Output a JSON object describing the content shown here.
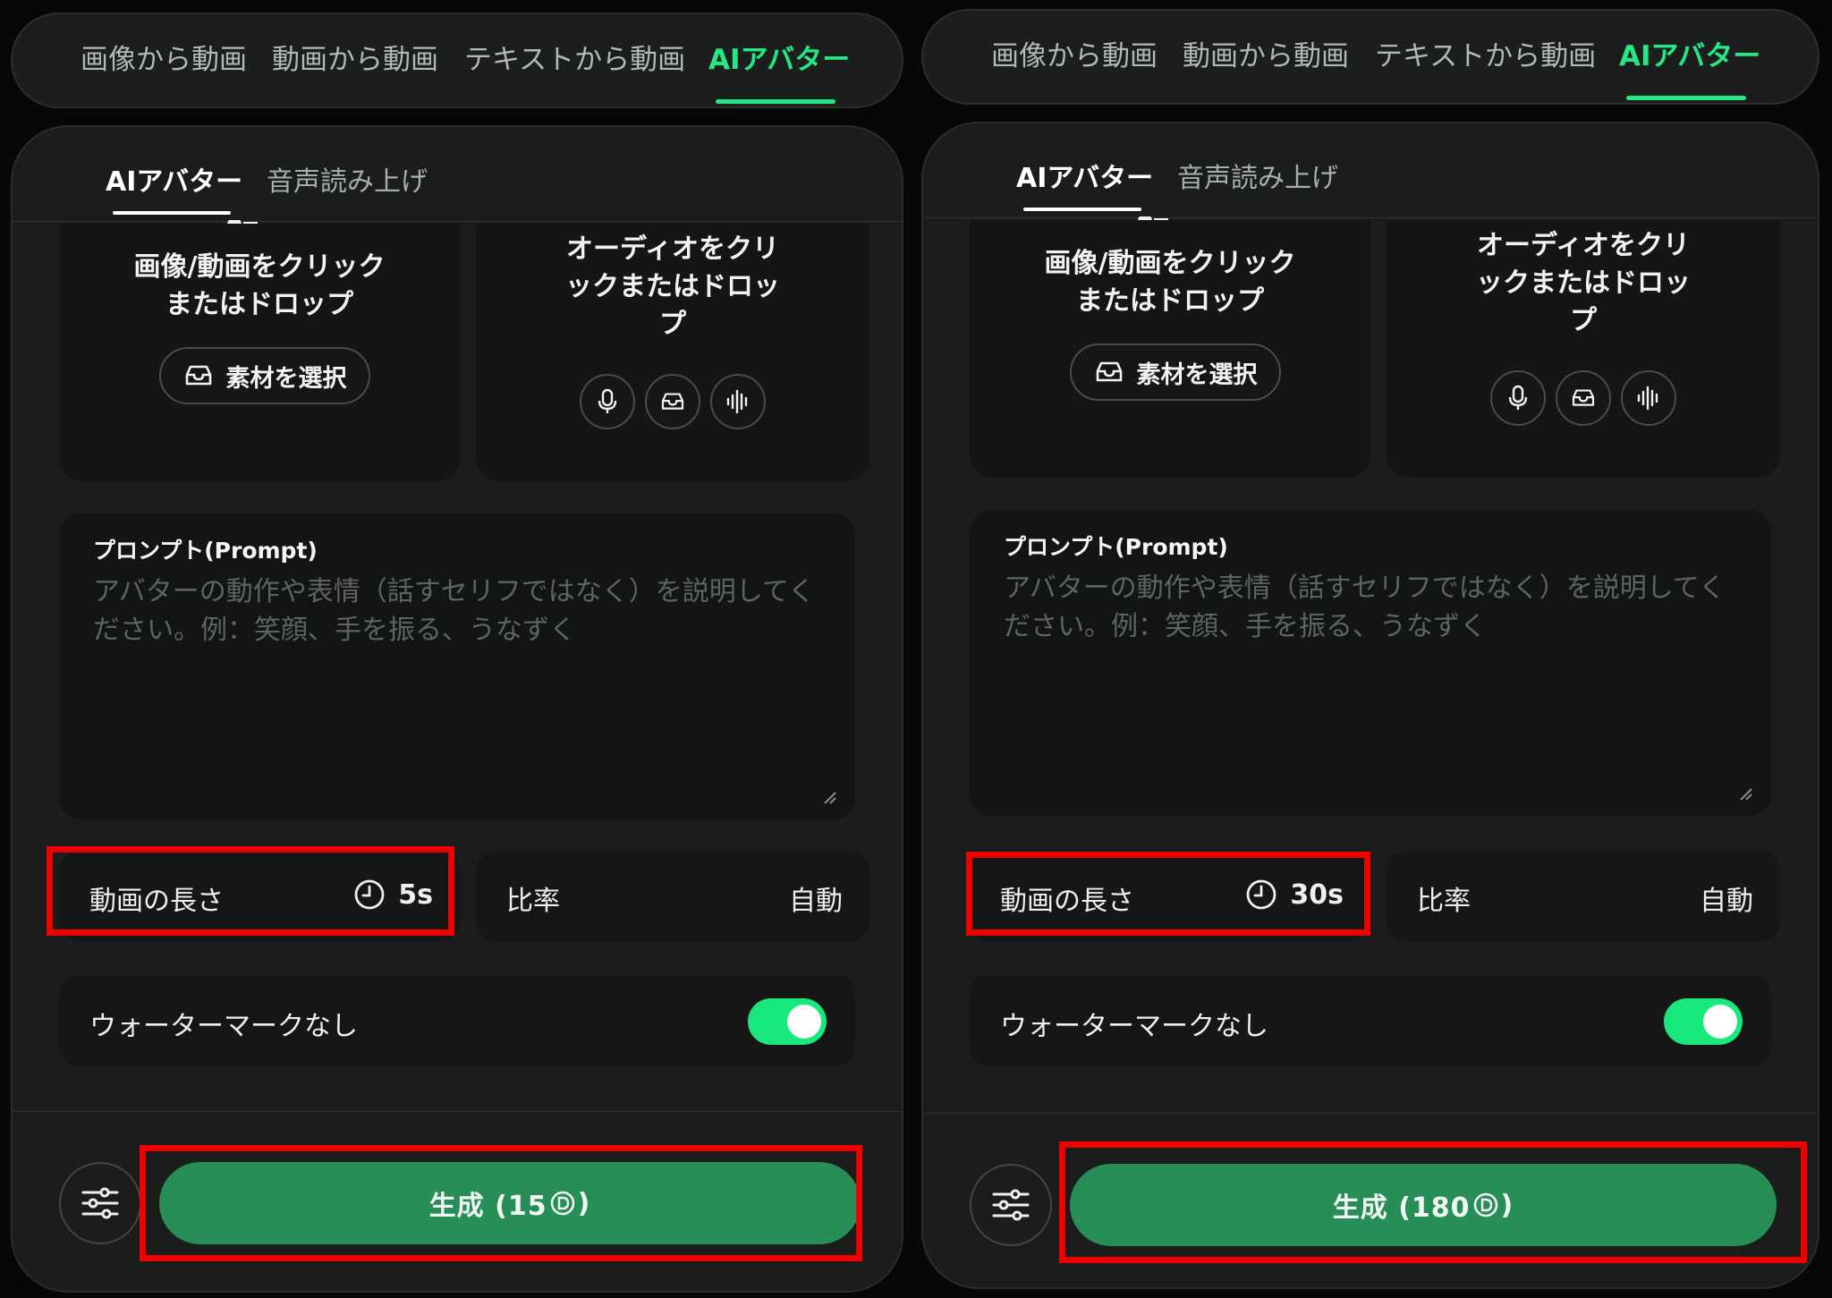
{
  "colors": {
    "accent": "#23e884",
    "generate": "#278e57",
    "highlight": "#f10000",
    "toggle_on": "#19e87c"
  },
  "panels": [
    {
      "nav_tabs": [
        "画像から動画",
        "動画から動画",
        "テキストから動画",
        "AIアバター"
      ],
      "active_nav_tab": "AIアバター",
      "sub_tabs": [
        "AIアバター",
        "音声読み上げ"
      ],
      "active_sub_tab": "AIアバター",
      "image_upload_text": "画像/動画をクリック\nまたはドロップ",
      "select_material_label": "素材を選択",
      "audio_upload_text": "オーディオをクリ\nックまたはドロッ\nプ",
      "audio_buttons": [
        "mic-icon",
        "tray-icon",
        "waveform-icon"
      ],
      "prompt_label": "プロンプト(Prompt)",
      "prompt_placeholder": "アバターの動作や表情（話すセリフではなく）を説明してください。例：笑顔、手を振る、うなずく",
      "duration_label": "動画の長さ",
      "duration_value": "5s",
      "ratio_label": "比率",
      "ratio_value": "自動",
      "watermark_label": "ウォーターマークなし",
      "watermark_on": true,
      "generate_label": "生成 (15",
      "generate_suffix": ")"
    },
    {
      "nav_tabs": [
        "画像から動画",
        "動画から動画",
        "テキストから動画",
        "AIアバター"
      ],
      "active_nav_tab": "AIアバター",
      "sub_tabs": [
        "AIアバター",
        "音声読み上げ"
      ],
      "active_sub_tab": "AIアバター",
      "image_upload_text": "画像/動画をクリック\nまたはドロップ",
      "select_material_label": "素材を選択",
      "audio_upload_text": "オーディオをクリ\nックまたはドロッ\nプ",
      "audio_buttons": [
        "mic-icon",
        "tray-icon",
        "waveform-icon"
      ],
      "prompt_label": "プロンプト(Prompt)",
      "prompt_placeholder": "アバターの動作や表情（話すセリフではなく）を説明してください。例：笑顔、手を振る、うなずく",
      "duration_label": "動画の長さ",
      "duration_value": "30s",
      "ratio_label": "比率",
      "ratio_value": "自動",
      "watermark_label": "ウォーターマークなし",
      "watermark_on": true,
      "generate_label": "生成 (180",
      "generate_suffix": ")"
    }
  ]
}
